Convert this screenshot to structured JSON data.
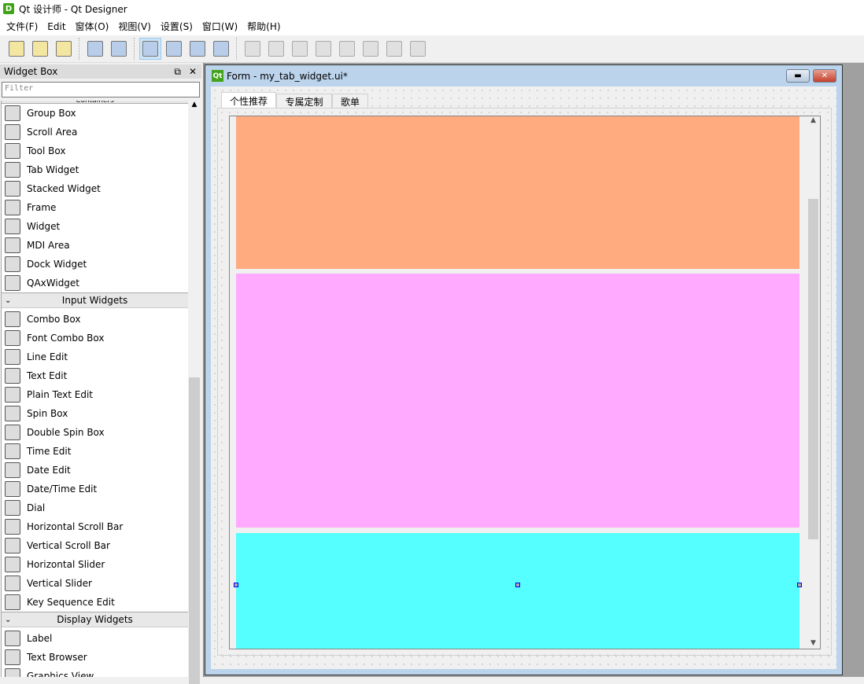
{
  "app": {
    "title": "Qt 设计师 - Qt Designer",
    "icon": "D"
  },
  "menu": [
    "文件(F)",
    "Edit",
    "窗体(O)",
    "视图(V)",
    "设置(S)",
    "窗口(W)",
    "帮助(H)"
  ],
  "toolbar": [
    "new-file-icon",
    "open-folder-icon",
    "save-icon",
    "|",
    "send-to-back-icon",
    "bring-to-front-icon",
    "|",
    "edit-widgets-icon",
    "edit-signals-slots-icon",
    "edit-buddies-icon",
    "edit-tab-order-icon",
    "|",
    "layout-horizontal-icon",
    "layout-vertical-icon",
    "layout-h-splitter-icon",
    "layout-v-splitter-icon",
    "layout-grid-icon",
    "layout-form-icon",
    "break-layout-icon",
    "adjust-size-icon"
  ],
  "widget_box": {
    "title": "Widget Box",
    "filter_placeholder": "Filter",
    "cut_category": "Containers",
    "groups": [
      {
        "items": [
          "Group Box",
          "Scroll Area",
          "Tool Box",
          "Tab Widget",
          "Stacked Widget",
          "Frame",
          "Widget",
          "MDI Area",
          "Dock Widget",
          "QAxWidget"
        ]
      },
      {
        "category": "Input Widgets",
        "items": [
          "Combo Box",
          "Font Combo Box",
          "Line Edit",
          "Text Edit",
          "Plain Text Edit",
          "Spin Box",
          "Double Spin Box",
          "Time Edit",
          "Date Edit",
          "Date/Time Edit",
          "Dial",
          "Horizontal Scroll Bar",
          "Vertical Scroll Bar",
          "Horizontal Slider",
          "Vertical Slider",
          "Key Sequence Edit"
        ]
      },
      {
        "category": "Display Widgets",
        "items": [
          "Label",
          "Text Browser",
          "Graphics View"
        ]
      }
    ]
  },
  "form": {
    "title": "Form - my_tab_widget.ui*",
    "tabs": [
      "个性推荐",
      "专属定制",
      "歌单"
    ],
    "active_tab": 0,
    "colors": {
      "block1": "#ffaa7f",
      "block2": "#ffaaff",
      "block3": "#55ffff"
    }
  }
}
